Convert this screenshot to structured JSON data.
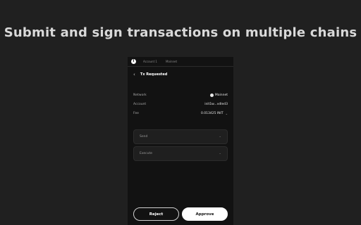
{
  "headline": "Submit and sign transactions on multiple chains",
  "wallet": {
    "logo_glyph": "i",
    "account_tab": "Account 1",
    "network_tab": "Mainnet",
    "title": "Tx Requested",
    "rows": [
      {
        "label": "Network",
        "value": "Mainnet"
      },
      {
        "label": "Account",
        "value": "init1w...vdled3"
      },
      {
        "label": "Fee",
        "value": "0.013425 INIT"
      }
    ],
    "sections": [
      {
        "label": "Send"
      },
      {
        "label": "Execute"
      }
    ],
    "reject_label": "Reject",
    "approve_label": "Approve"
  },
  "colors": {
    "background": "#202020",
    "panel": "#121212",
    "approve_bg": "#ffffff"
  }
}
